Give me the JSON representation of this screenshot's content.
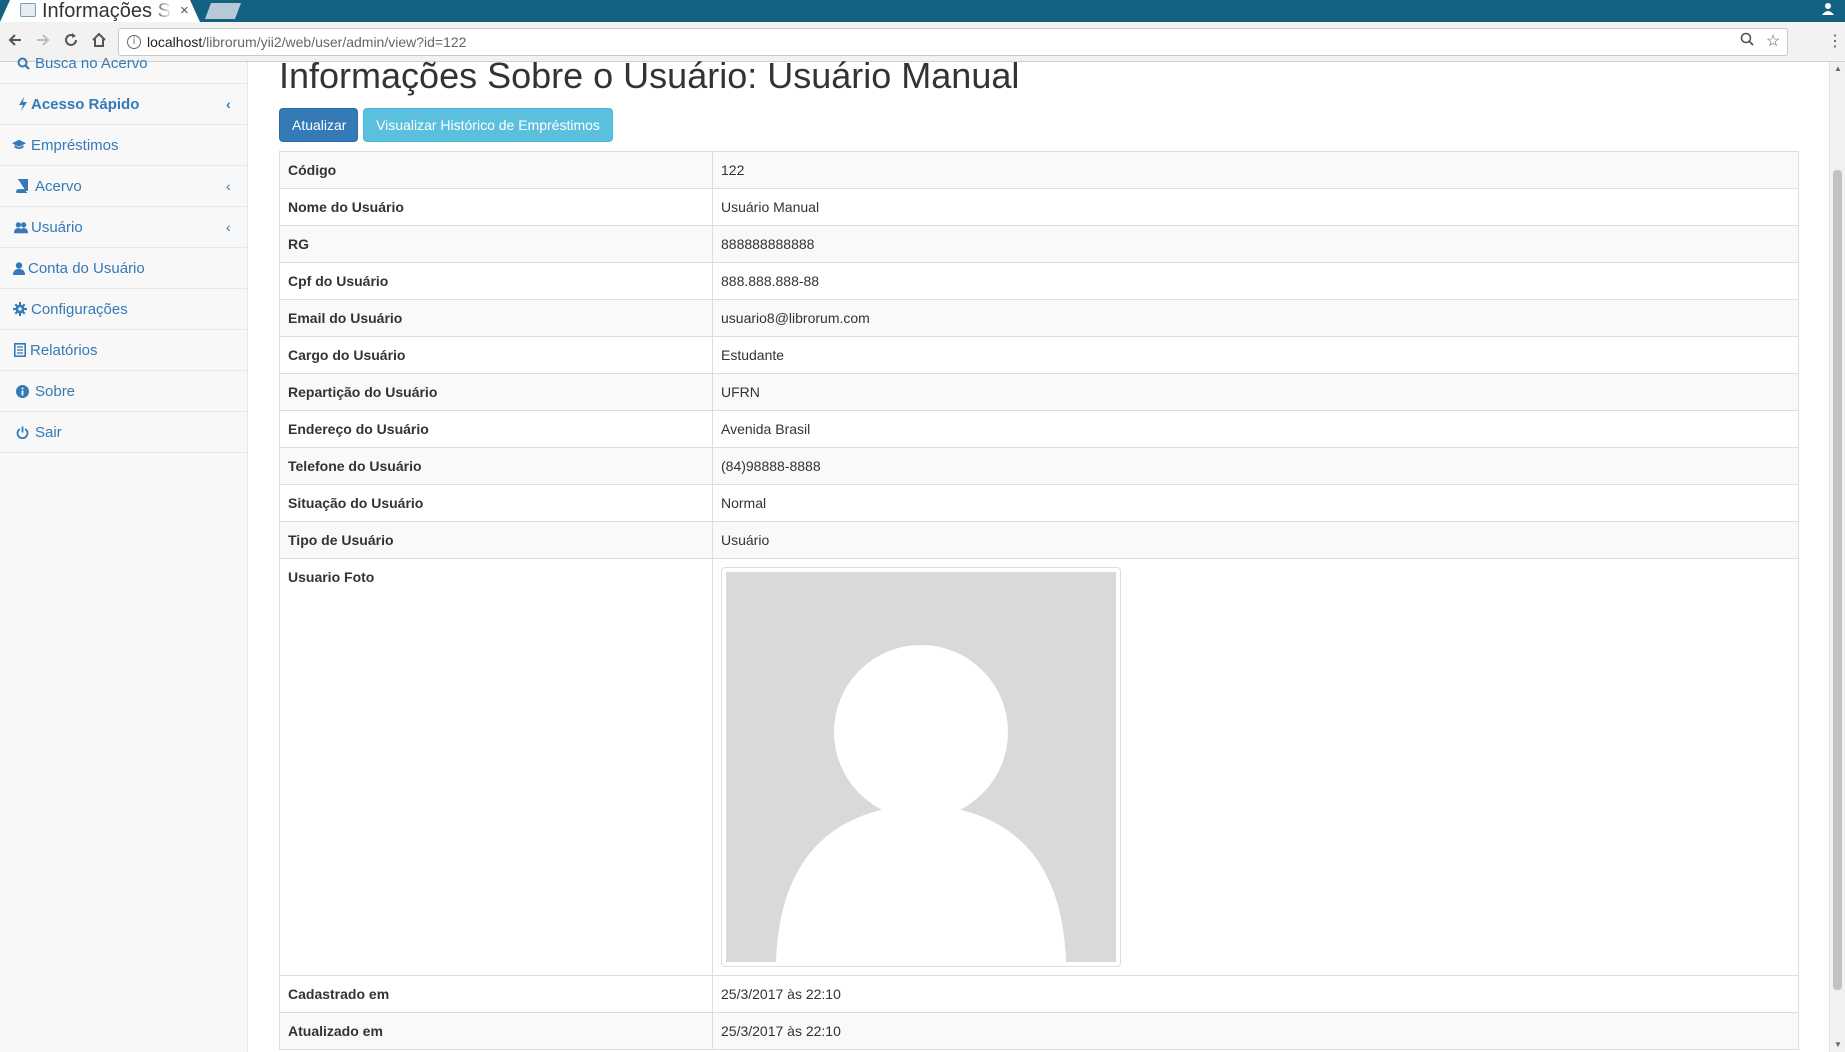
{
  "browser": {
    "tab_title": "Informações Sobre o Usuário: Usuário Manual",
    "tab_close": "×",
    "url_host": "localhost",
    "url_path": "/librorum/yii2/web/user/admin/view?id=122"
  },
  "sidebar": {
    "items": [
      {
        "label": "Busca no Acervo",
        "icon": "search-icon"
      },
      {
        "label": "Acesso Rápido",
        "icon": "bolt-icon",
        "chevron": "‹"
      },
      {
        "label": "Empréstimos",
        "icon": "graduation-cap-icon"
      },
      {
        "label": "Acervo",
        "icon": "book-icon",
        "chevron": "‹"
      },
      {
        "label": "Usuário",
        "icon": "users-icon",
        "chevron": "‹"
      },
      {
        "label": "Conta do Usuário",
        "icon": "user-icon"
      },
      {
        "label": "Configurações",
        "icon": "gear-icon"
      },
      {
        "label": "Relatórios",
        "icon": "report-icon"
      },
      {
        "label": "Sobre",
        "icon": "info-circle-icon"
      },
      {
        "label": "Sair",
        "icon": "power-icon"
      }
    ]
  },
  "main": {
    "title": "Informações Sobre o Usuário: Usuário Manual",
    "buttons": {
      "update": "Atualizar",
      "history": "Visualizar Histórico de Empréstimos"
    },
    "details": [
      {
        "label": "Código",
        "value": "122"
      },
      {
        "label": "Nome do Usuário",
        "value": "Usuário Manual"
      },
      {
        "label": "RG",
        "value": "888888888888"
      },
      {
        "label": "Cpf do Usuário",
        "value": "888.888.888-88"
      },
      {
        "label": "Email do Usuário",
        "value": "usuario8@librorum.com"
      },
      {
        "label": "Cargo do Usuário",
        "value": "Estudante"
      },
      {
        "label": "Repartição do Usuário",
        "value": "UFRN"
      },
      {
        "label": "Endereço do Usuário",
        "value": "Avenida Brasil"
      },
      {
        "label": "Telefone do Usuário",
        "value": "(84)98888-8888"
      },
      {
        "label": "Situação do Usuário",
        "value": "Normal"
      },
      {
        "label": "Tipo de Usuário",
        "value": "Usuário"
      },
      {
        "label": "Usuario Foto",
        "value": ""
      },
      {
        "label": "Cadastrado em",
        "value": "25/3/2017 às 22:10"
      },
      {
        "label": "Atualizado em",
        "value": "25/3/2017 às 22:10"
      }
    ]
  },
  "colors": {
    "browser_bar": "#146282",
    "link": "#337ab7",
    "primary": "#337ab7",
    "info": "#5bc0de",
    "avatar_bg": "#d9d9d9"
  }
}
